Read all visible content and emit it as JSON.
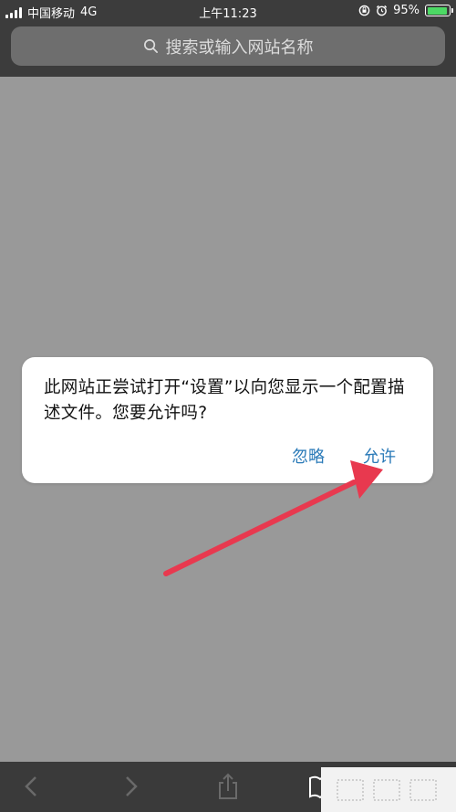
{
  "status_bar": {
    "carrier": "中国移动",
    "network": "4G",
    "time": "上午11:23",
    "battery_percent": "95%",
    "battery_level": 0.95
  },
  "address_bar": {
    "placeholder": "搜索或输入网站名称",
    "icon": "search-icon"
  },
  "alert": {
    "message": "此网站正尝试打开“设置”以向您显示一个配置描述文件。您要允许吗?",
    "ignore_label": "忽略",
    "allow_label": "允许"
  },
  "toolbar": {
    "icons": [
      "back-icon",
      "forward-icon",
      "share-icon",
      "bookmarks-icon"
    ]
  },
  "colors": {
    "overlay_gray": "#999999",
    "chrome_dark": "#3c3c3c",
    "button_blue": "#2a7ab8",
    "arrow_red": "#e8394f",
    "battery_green": "#4cd964"
  }
}
